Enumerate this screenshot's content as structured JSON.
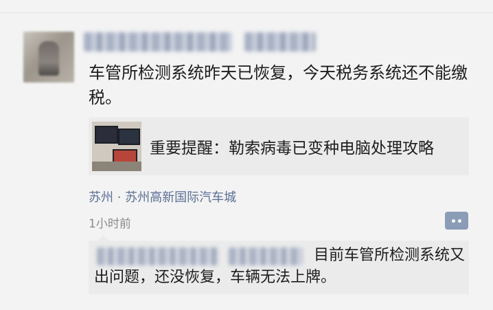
{
  "post": {
    "text": "车管所检测系统昨天已恢复，今天税务系统还不能缴税。",
    "link": {
      "title": "重要提醒：勒索病毒已变种电脑处理攻略"
    },
    "location": "苏州 · 苏州高新国际汽车城",
    "time": "1小时前"
  },
  "comment": {
    "text": "目前车管所检测系统又出问题，还没恢复，车辆无法上牌。"
  },
  "colors": {
    "background": "#f3f3f3",
    "link_card": "#ebebeb",
    "location_text": "#5a6f95",
    "comment_button": "#8a9cb6"
  }
}
